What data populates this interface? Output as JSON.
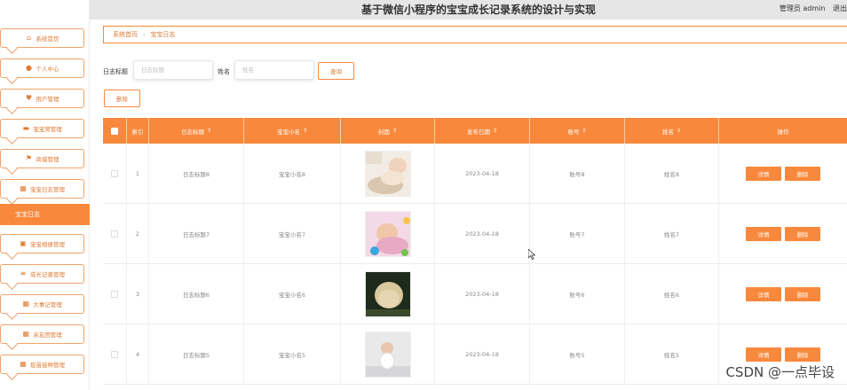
{
  "header": {
    "title": "基于微信小程序的宝宝成长记录系统的设计与实现",
    "user": "管理员 admin",
    "logout": "退出"
  },
  "sidebar": {
    "items": [
      {
        "label": "系统首页",
        "icon": "home-icon"
      },
      {
        "label": "个人中心",
        "icon": "user-icon"
      },
      {
        "label": "用户管理",
        "icon": "users-icon"
      },
      {
        "label": "宝宝窝管理",
        "icon": "crib-icon"
      },
      {
        "label": "商城管理",
        "icon": "flag-icon"
      },
      {
        "label": "宝宝日志管理",
        "icon": "grid-icon"
      }
    ],
    "active": "宝宝日志",
    "items_after": [
      {
        "label": "宝宝相册管理",
        "icon": "album-icon"
      },
      {
        "label": "成长记录管理",
        "icon": "list-icon"
      },
      {
        "label": "大事记管理",
        "icon": "grid-icon"
      },
      {
        "label": "亲友团管理",
        "icon": "grid-icon"
      },
      {
        "label": "疫苗接种管理",
        "icon": "grid-icon"
      }
    ]
  },
  "breadcrumb": {
    "home": "系统首页",
    "sep": ":",
    "current": "宝宝日志"
  },
  "search": {
    "title_label": "日志标题",
    "title_placeholder": "日志标题",
    "name_label": "姓名",
    "name_placeholder": "姓名",
    "query_button": "查询"
  },
  "actions": {
    "delete_button": "删除"
  },
  "table": {
    "columns": [
      "索引",
      "日志标题",
      "宝宝小名",
      "封面",
      "发布日期",
      "账号",
      "姓名",
      "操作"
    ],
    "sortable": [
      "日志标题",
      "宝宝小名",
      "封面",
      "发布日期",
      "账号",
      "姓名"
    ],
    "sort_glyph": "⇕",
    "rows": [
      {
        "index": "1",
        "title": "日志标题8",
        "nickname": "宝宝小名8",
        "date": "2023-04-18",
        "account": "账号8",
        "name": "姓名8"
      },
      {
        "index": "2",
        "title": "日志标题7",
        "nickname": "宝宝小名7",
        "date": "2023-04-18",
        "account": "账号7",
        "name": "姓名7"
      },
      {
        "index": "3",
        "title": "日志标题6",
        "nickname": "宝宝小名6",
        "date": "2023-04-18",
        "account": "账号6",
        "name": "姓名6"
      },
      {
        "index": "4",
        "title": "日志标题5",
        "nickname": "宝宝小名5",
        "date": "2023-04-18",
        "account": "账号5",
        "name": "姓名5"
      }
    ],
    "detail_button": "详情",
    "delete_button": "删除"
  },
  "watermark": "CSDN @一点毕设",
  "colors": {
    "accent": "#f8893c",
    "header_bg": "#e6e6e6"
  }
}
